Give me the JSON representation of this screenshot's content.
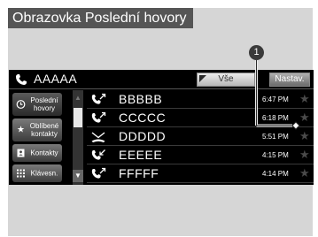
{
  "title": "Obrazovka Poslední hovory",
  "header": {
    "caller": "AAAAA",
    "filter_label": "Vše",
    "settings_label": "Nastav."
  },
  "sidebar": {
    "items": [
      {
        "label": "Poslední hovory",
        "icon": "recent-clock-icon"
      },
      {
        "label": "Oblíbené kontakty",
        "icon": "star-icon"
      },
      {
        "label": "Kontakty",
        "icon": "contacts-book-icon"
      },
      {
        "label": "Klávesn.",
        "icon": "keypad-icon"
      }
    ]
  },
  "calls": [
    {
      "name": "BBBBB",
      "time": "6:47 PM",
      "type": "outgoing"
    },
    {
      "name": "CCCCC",
      "time": "6:18 PM",
      "type": "outgoing"
    },
    {
      "name": "DDDDD",
      "time": "5:51 PM",
      "type": "missed"
    },
    {
      "name": "EEEEE",
      "time": "4:15 PM",
      "type": "incoming"
    },
    {
      "name": "FFFFF",
      "time": "4:14 PM",
      "type": "outgoing"
    }
  ],
  "callout": {
    "number": "1"
  },
  "colors": {
    "screen": "#000000",
    "frame": "#d6d6d6",
    "title_bar": "#555555",
    "text": "#ffffff"
  }
}
